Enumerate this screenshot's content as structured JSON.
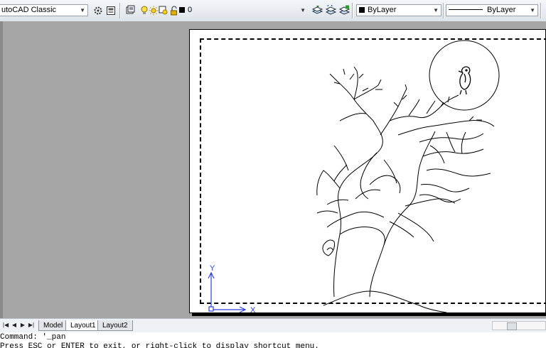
{
  "toolbar": {
    "workspace": "utoCAD Classic",
    "layer_name": "0",
    "color": "ByLayer",
    "linetype": "ByLayer"
  },
  "layout_tabs": [
    "Model",
    "Layout1",
    "Layout2"
  ],
  "active_tab": "Layout1",
  "ucs": {
    "x_label": "X",
    "y_label": "Y"
  },
  "command_line": {
    "line1": "Command: '_pan",
    "line2": "Press ESC or ENTER to exit, or right-click to display shortcut menu."
  },
  "colors": {
    "ucs_blue": "#2d3fd8",
    "layer_bg": "#a5a5a5",
    "paper": "#ffffff"
  }
}
